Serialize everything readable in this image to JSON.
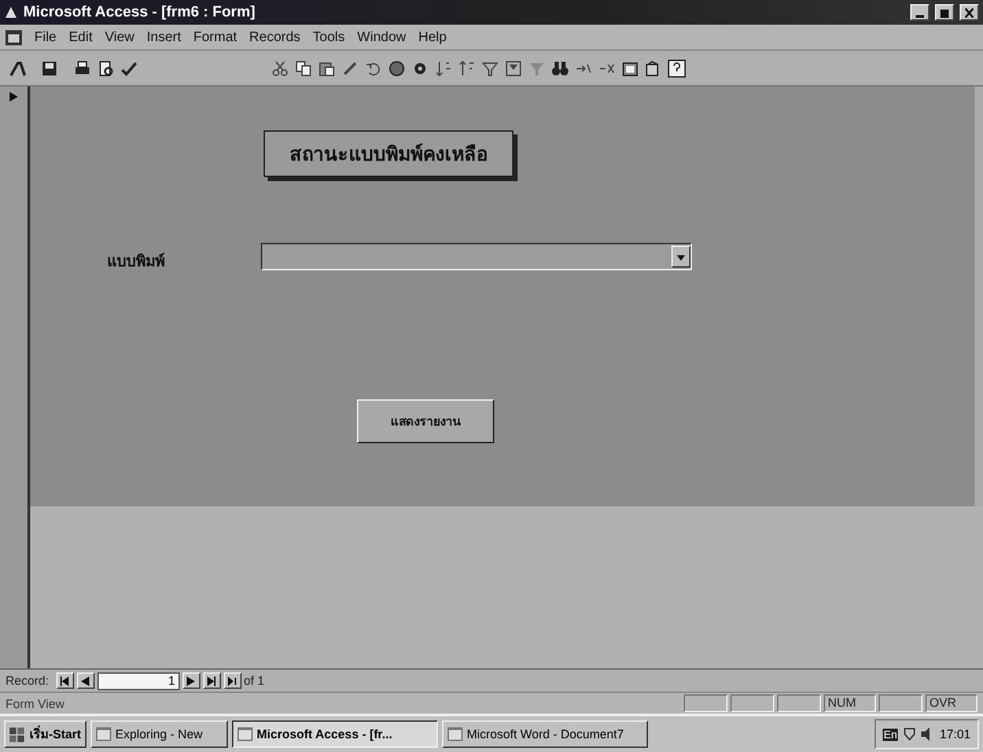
{
  "window": {
    "title": "Microsoft Access - [frm6 : Form]"
  },
  "menu": [
    "File",
    "Edit",
    "View",
    "Insert",
    "Format",
    "Records",
    "Tools",
    "Window",
    "Help"
  ],
  "form": {
    "heading": "สถานะแบบพิมพ์คงเหลือ",
    "field_label": "แบบพิมพ์",
    "button": "แสดงรายงาน"
  },
  "record_nav": {
    "label": "Record:",
    "current": "1",
    "total": "of 1"
  },
  "status_bar": {
    "text": "Form View",
    "indicators": [
      "NUM",
      "OVR"
    ]
  },
  "taskbar": {
    "start": "เริ่ม-Start",
    "tasks": [
      {
        "label": "Exploring - New",
        "selected": false
      },
      {
        "label": "Microsoft Access - [fr...",
        "selected": true
      },
      {
        "label": "Microsoft Word - Document7",
        "selected": false
      }
    ],
    "tray_lang": "En",
    "clock": "17:01"
  }
}
